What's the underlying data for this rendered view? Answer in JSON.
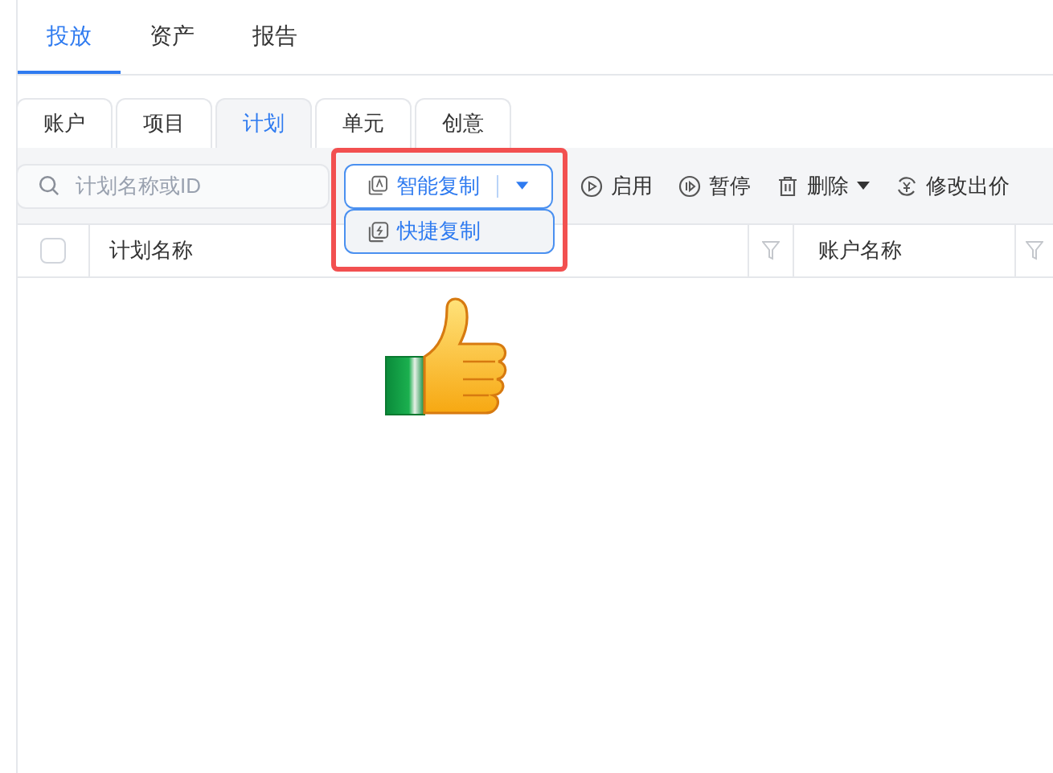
{
  "main_tabs": [
    {
      "label": "投放",
      "selected": true
    },
    {
      "label": "资产",
      "selected": false
    },
    {
      "label": "报告",
      "selected": false
    }
  ],
  "sub_tabs": [
    {
      "label": "账户",
      "selected": false
    },
    {
      "label": "项目",
      "selected": false
    },
    {
      "label": "计划",
      "selected": true
    },
    {
      "label": "单元",
      "selected": false
    },
    {
      "label": "创意",
      "selected": false
    }
  ],
  "search": {
    "placeholder": "计划名称或ID"
  },
  "copy_button": {
    "label": "智能复制",
    "expanded": true
  },
  "dropdown_menu": [
    {
      "label": "快捷复制"
    }
  ],
  "toolbar_actions": [
    {
      "kind": "enable",
      "label": "启用",
      "dropdown": false
    },
    {
      "kind": "pause",
      "label": "暂停",
      "dropdown": false
    },
    {
      "kind": "delete",
      "label": "删除",
      "dropdown": true
    },
    {
      "kind": "bid",
      "label": "修改出价",
      "dropdown": false
    }
  ],
  "table": {
    "select_all": {
      "checked": false
    },
    "columns": [
      {
        "label": "计划名称"
      },
      {
        "label": "账户名称"
      }
    ]
  }
}
